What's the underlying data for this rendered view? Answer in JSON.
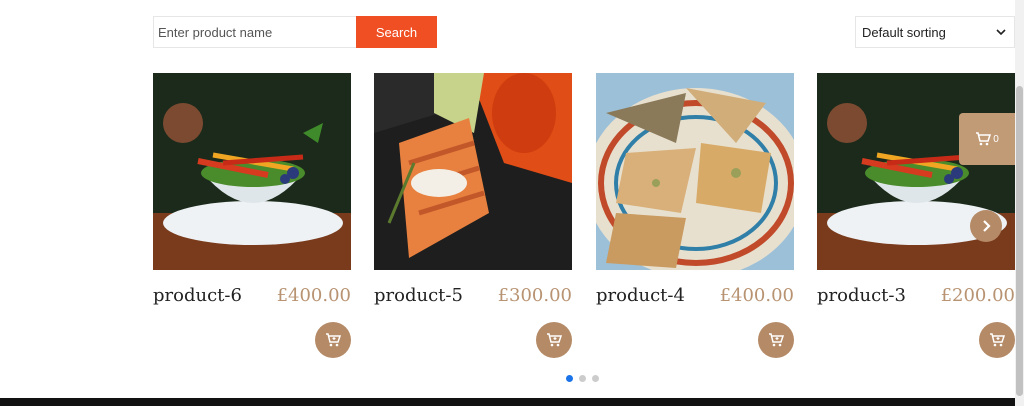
{
  "search": {
    "placeholder": "Enter product name",
    "button_label": "Search"
  },
  "sort": {
    "selected": "Default sorting"
  },
  "floating_cart": {
    "count": "0"
  },
  "products": [
    {
      "name": "product-6",
      "price": "£400.00",
      "image": "salad-bowl"
    },
    {
      "name": "product-5",
      "price": "£300.00",
      "image": "grilled-salmon"
    },
    {
      "name": "product-4",
      "price": "£400.00",
      "image": "pastries"
    },
    {
      "name": "product-3",
      "price": "£200.00",
      "image": "salad-bowl"
    }
  ],
  "carousel": {
    "pages": 3,
    "active_page": 1
  },
  "colors": {
    "accent": "#f04e23",
    "brand": "#b58a66",
    "price": "#b89372",
    "dot_active": "#1a73e8"
  }
}
